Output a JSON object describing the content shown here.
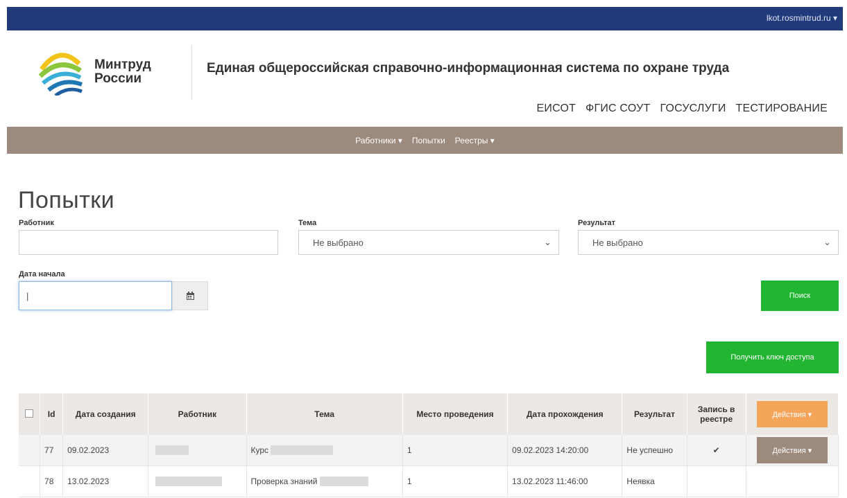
{
  "topbar": {
    "user": "lkot.rosmintrud.ru ▾"
  },
  "brand": {
    "line1": "Минтруд",
    "line2": "России"
  },
  "system_title": "Единая общероссийская справочно-информационная система по охране труда",
  "external_nav": [
    "ЕИСОТ",
    "ФГИС СОУТ",
    "ГОСУСЛУГИ",
    "ТЕСТИРОВАНИЕ"
  ],
  "main_nav": [
    "Работники ▾",
    "Попытки",
    "Реестры ▾"
  ],
  "page_title": "Попытки",
  "filters": {
    "worker_label": "Работник",
    "worker_value": "",
    "topic_label": "Тема",
    "topic_value": "Не выбрано",
    "result_label": "Результат",
    "result_value": "Не выбрано",
    "date_label": "Дата начала",
    "date_value": "|"
  },
  "buttons": {
    "search": "Поиск",
    "get_key": "Получить ключ доступа"
  },
  "table": {
    "headers": {
      "id": "Id",
      "created": "Дата создания",
      "worker": "Работник",
      "topic": "Тема",
      "place": "Место проведения",
      "passed": "Дата прохождения",
      "result": "Результат",
      "registry": "Запись в реестре",
      "actions": "Действия ▾"
    },
    "rows": [
      {
        "id": "77",
        "created": "09.02.2023",
        "topic": "Курс",
        "place": "1",
        "passed": "09.02.2023 14:20:00",
        "result": "Не успешно",
        "registry": "✔",
        "actions": "Действия ▾"
      },
      {
        "id": "78",
        "created": "13.02.2023",
        "topic": "Проверка знаний",
        "place": "1",
        "passed": "13.02.2023 11:46:00",
        "result": "Неявка",
        "registry": "",
        "actions": ""
      }
    ]
  },
  "colors": {
    "topbar": "#213a7c",
    "nav": "#9c8a7f",
    "green": "#22b532",
    "orange": "#f4a55a"
  }
}
